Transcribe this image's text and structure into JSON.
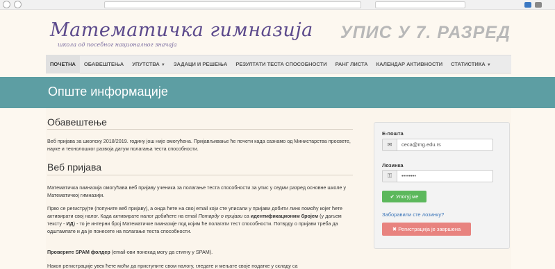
{
  "header": {
    "logo_title": "Математичка гимназија",
    "logo_subtitle": "школа од посебног националног значаја",
    "enrollment_title": "УПИС У 7. РАЗРЕД"
  },
  "nav": {
    "items": [
      {
        "label": "Почетна",
        "active": true
      },
      {
        "label": "Обавештења"
      },
      {
        "label": "Упутства",
        "dropdown": true
      },
      {
        "label": "Задаци и решења"
      },
      {
        "label": "Резултати теста способности"
      },
      {
        "label": "Ранг листа"
      },
      {
        "label": "Календар активности"
      },
      {
        "label": "Статистика",
        "dropdown": true
      }
    ]
  },
  "banner": {
    "title": "Опште информације"
  },
  "content": {
    "notice_heading": "Обавештење",
    "notice_text": "Веб пријава за школску 2018/2019. годину још није омогућена. Пријављивање ће почети када сазнамо од Министарства просвете, науке и технолошког развоја датум полагања теста способности.",
    "web_heading": "Веб пријава",
    "web_text": "Математичка гимназија омогућава веб пријаву ученика за полагање теста способности за упис у седми разред основне школе у Математичкој гимназији.",
    "p3_a": "Прво се региструјте (попуните веб пријаву), а онда ћете на свој email који сте уписали у пријави добити линк помоћу којег ћете активирати свој налог. Када активирате налог добићете на email ",
    "p3_italic": "Потврду о пријави",
    "p3_b": " са ",
    "p3_bold": "идентификационим бројем",
    "p3_c": " (у даљем тексту - ",
    "p3_id": "ИД",
    "p3_d": ") - то је интерни број Математичке гимназије под којим ће полагати тест способности. Потврду о пријави треба да одштампате и да је понесете на полагање теста способности.",
    "spam_bold": "Проверите SPAM фолдер",
    "spam_rest": " (email-ови понекад могу да стигну у SPAM).",
    "p5": "Након регистрације увек ћете моћи да приступите свом налогу, гледате и мењате своје податке у складу са"
  },
  "login": {
    "email_label": "Е-пошта",
    "email_value": "ceca@mg.edu.rs",
    "password_label": "Лозинка",
    "password_value": "••••••••",
    "login_button": "Улогуј ме",
    "forgot_link": "Заборавили сте лозинку?",
    "register_button": "Регистрација је завршена"
  },
  "colors": {
    "banner": "#5d9ea3",
    "login_button": "#5cb85c",
    "register_button": "#e8837f",
    "logo": "#5c4a8c"
  }
}
